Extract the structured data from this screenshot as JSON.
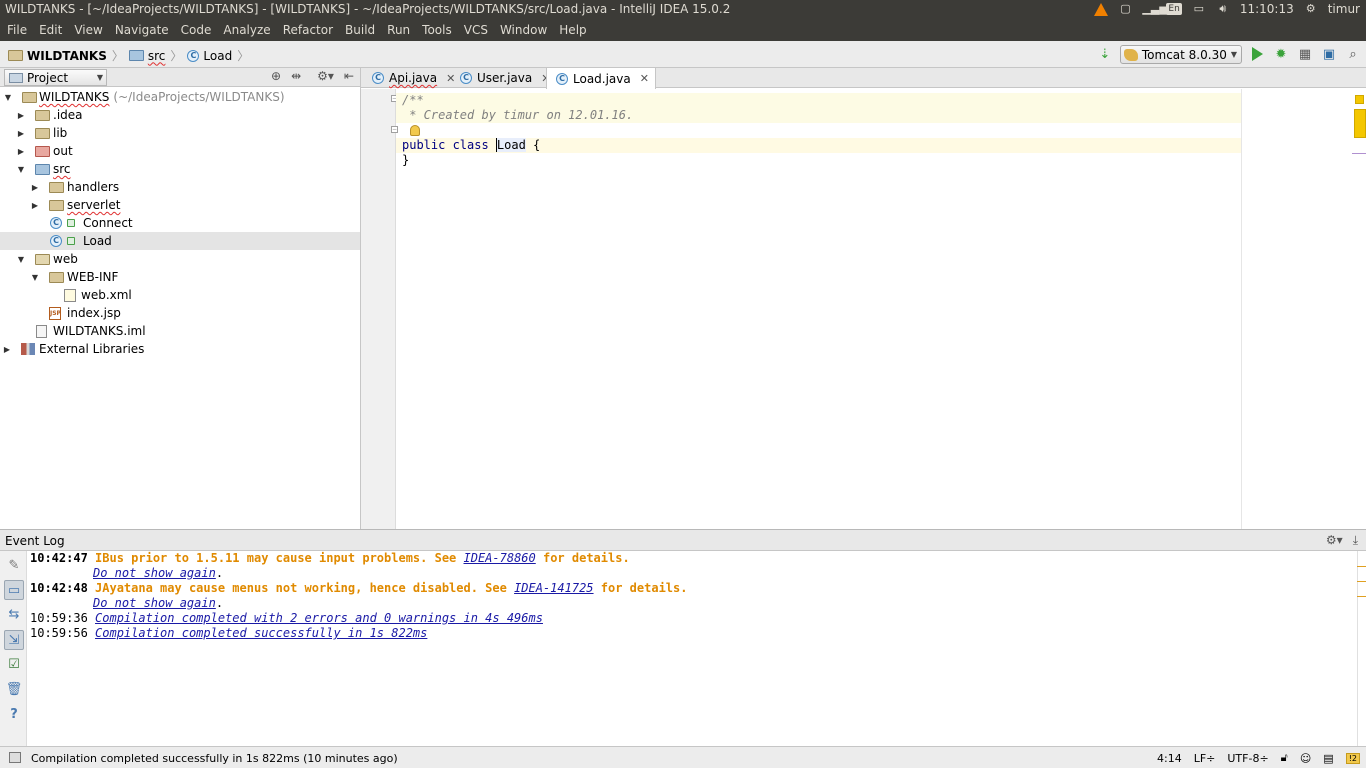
{
  "window": {
    "title": "WILDTANKS - [~/IdeaProjects/WILDTANKS] - [WILDTANKS] - ~/IdeaProjects/WILDTANKS/src/Load.java - IntelliJ IDEA 15.0.2",
    "tray": {
      "lang": "En",
      "clock": "11:10:13",
      "user": "timur"
    }
  },
  "menu": [
    "File",
    "Edit",
    "View",
    "Navigate",
    "Code",
    "Analyze",
    "Refactor",
    "Build",
    "Run",
    "Tools",
    "VCS",
    "Window",
    "Help"
  ],
  "breadcrumbs": [
    "WILDTANKS",
    "src",
    "Load"
  ],
  "run_config": "Tomcat 8.0.30",
  "project_panel": {
    "selector": "Project",
    "tree": [
      {
        "label": "WILDTANKS",
        "hint": "(~/IdeaProjects/WILDTANKS)"
      },
      {
        "label": ".idea"
      },
      {
        "label": "lib"
      },
      {
        "label": "out"
      },
      {
        "label": "src"
      },
      {
        "label": "handlers"
      },
      {
        "label": "serverlet"
      },
      {
        "label": "Connect"
      },
      {
        "label": "Load"
      },
      {
        "label": "web"
      },
      {
        "label": "WEB-INF"
      },
      {
        "label": "web.xml"
      },
      {
        "label": "index.jsp"
      },
      {
        "label": "WILDTANKS.iml"
      },
      {
        "label": "External Libraries"
      }
    ]
  },
  "editor": {
    "tabs": [
      "Api.java",
      "User.java",
      "Load.java"
    ],
    "active_tab": "Load.java",
    "code": {
      "line1": "/**",
      "line2": " * Created by timur on 12.01.16.",
      "line3_kw": "public class ",
      "line3_name": "Load",
      "line3_tail": " {",
      "line4": "}"
    }
  },
  "event_log": {
    "title": "Event Log",
    "entries": [
      {
        "time": "10:42:47",
        "pre": "IBus prior to 1.5.11 may cause input problems. See ",
        "link": "IDEA-78860",
        "post": " for details.",
        "action": "Do not show again",
        "action_post": "."
      },
      {
        "time": "10:42:48",
        "pre": "JAyatana may cause menus not working, hence disabled. See ",
        "link": "IDEA-141725",
        "post": " for details.",
        "action": "Do not show again",
        "action_post": "."
      },
      {
        "time": "10:59:36",
        "msg": "Compilation completed with 2 errors and 0 warnings in 4s 496ms"
      },
      {
        "time": "10:59:56",
        "msg": "Compilation completed successfully in 1s 822ms"
      }
    ]
  },
  "status": {
    "message": "Compilation completed successfully in 1s 822ms (10 minutes ago)",
    "position": "4:14",
    "line_sep": "LF÷",
    "encoding": "UTF-8÷",
    "warnings": "2"
  }
}
